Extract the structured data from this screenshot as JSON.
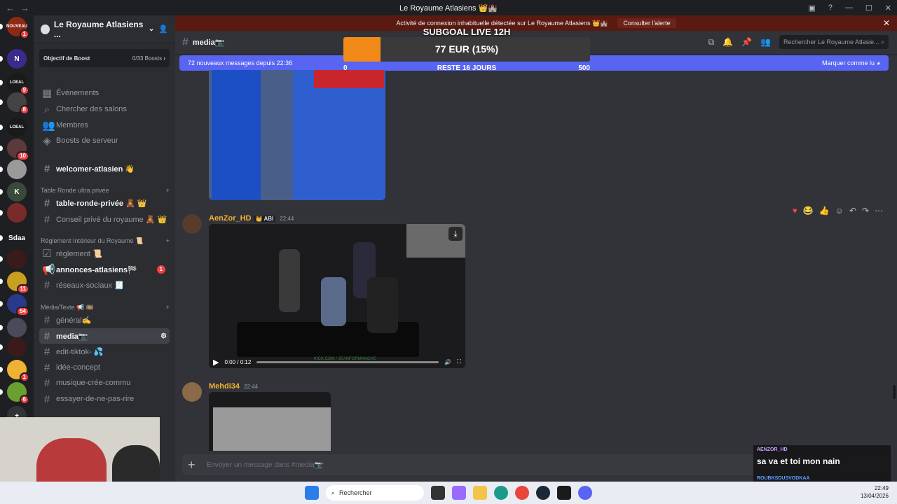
{
  "window": {
    "title": "Le Royaume Atlasiens 👑🏰",
    "back": "←",
    "forward": "→"
  },
  "guilds": [
    {
      "label": "NOUVEAU",
      "badge": "1",
      "color": "#8c2a14"
    },
    {
      "label": "N",
      "badge": "",
      "color": "#3b2b8a"
    },
    {
      "label": "LOEAL",
      "badge": "9",
      "color": "#1a1a1a"
    },
    {
      "label": "",
      "badge": "8",
      "color": "#444"
    },
    {
      "label": "LOEAL",
      "badge": "",
      "color": "#1a1a1a"
    },
    {
      "label": "",
      "badge": "10",
      "color": "#5a3a3a"
    },
    {
      "label": "",
      "badge": "",
      "color": "#9a9a9a"
    },
    {
      "label": "K",
      "badge": "",
      "color": "#3a4a3a"
    },
    {
      "label": "",
      "badge": "",
      "color": "#7a2a2a"
    },
    {
      "label": "Sdaa",
      "badge": "",
      "color": "#1e1f22"
    },
    {
      "label": "",
      "badge": "",
      "color": "#3a1a1a"
    },
    {
      "label": "",
      "badge": "11",
      "color": "#c8a020"
    },
    {
      "label": "",
      "badge": "54",
      "color": "#2a3a8a"
    },
    {
      "label": "",
      "badge": "",
      "color": "#4a4a5a"
    },
    {
      "label": "",
      "badge": "",
      "color": "#3a1a1a"
    },
    {
      "label": "",
      "badge": "1",
      "color": "#f0b232"
    },
    {
      "label": "",
      "badge": "6",
      "color": "#6aa030"
    }
  ],
  "server": {
    "name": "Le Royaume Atlasiens ...",
    "boost_label": "Objectif de Boost",
    "boost_count": "0/33 Boosts",
    "boost_arrow": "›",
    "menu": [
      {
        "label": "Événements",
        "icon": "calendar-icon"
      },
      {
        "label": "Chercher des salons",
        "icon": "search-icon"
      },
      {
        "label": "Membres",
        "icon": "members-icon"
      },
      {
        "label": "Boosts de serveur",
        "icon": "boost-icon"
      }
    ],
    "welcome": "welcomer-atlasien 👋",
    "cat1": "Table Ronde ultra privée",
    "cat1_items": [
      "table-ronde-privée 🧸 👑",
      "Conseil privé du royaume 🧸 👑"
    ],
    "cat2": "Règlement Intérieur du Royaume 📜",
    "cat2_items": [
      "règlement 📜",
      "annonces-atlasiens🏁",
      "réseaux-sociaux 🧾"
    ],
    "annonces_badge": "1",
    "cat3": "Média/Texte 📢 🎞️",
    "cat3_items": [
      "général✍️",
      "media📷",
      "edit-tiktok- 💦",
      "idée-concept",
      "musique-crée-commu",
      "essayer-de-ne-pas-rire"
    ]
  },
  "alert": {
    "text": "Activité de connexion inhabituelle détectée sur Le Royaume Atlasiens 👑🏰",
    "button": "Consulter l'alerte",
    "close": "✕"
  },
  "channel": {
    "name": "media📷",
    "search_placeholder": "Rechercher Le Royaume Atlasie..."
  },
  "newbar": {
    "text": "72 nouveaux messages depuis 22:36",
    "action": "Marquer comme lu"
  },
  "messages": [
    {
      "author": "AenZor_HD",
      "tag": "👑 ABI",
      "time": "22:44",
      "video_time": "0:00 / 0:12",
      "watermark": "KICK.COM / JEANFORMANOVE"
    },
    {
      "author": "Mehdi34",
      "time": "22:44"
    }
  ],
  "composer": {
    "placeholder": "Envoyer un message dans #media📷",
    "plus": "+"
  },
  "goal": {
    "title": "SUBGOAL LIVE 12H",
    "amount": "77 EUR (15%)",
    "min": "0",
    "remaining": "RESTE 16 JOURS",
    "max": "500",
    "progress": 0.15
  },
  "chat_overlay": {
    "user1": "AENZOR_HD",
    "msg1": "sa va et toi mon nain",
    "user2": "ROUBKSDUSVODKAA"
  },
  "taskbar": {
    "search": "Rechercher",
    "time": "22:49",
    "date": "13/04/2026"
  },
  "colors": {
    "accent": "#5865f2",
    "alert": "#5a1a12",
    "goal_fill": "#f28a1a",
    "username": "#f0b232"
  }
}
